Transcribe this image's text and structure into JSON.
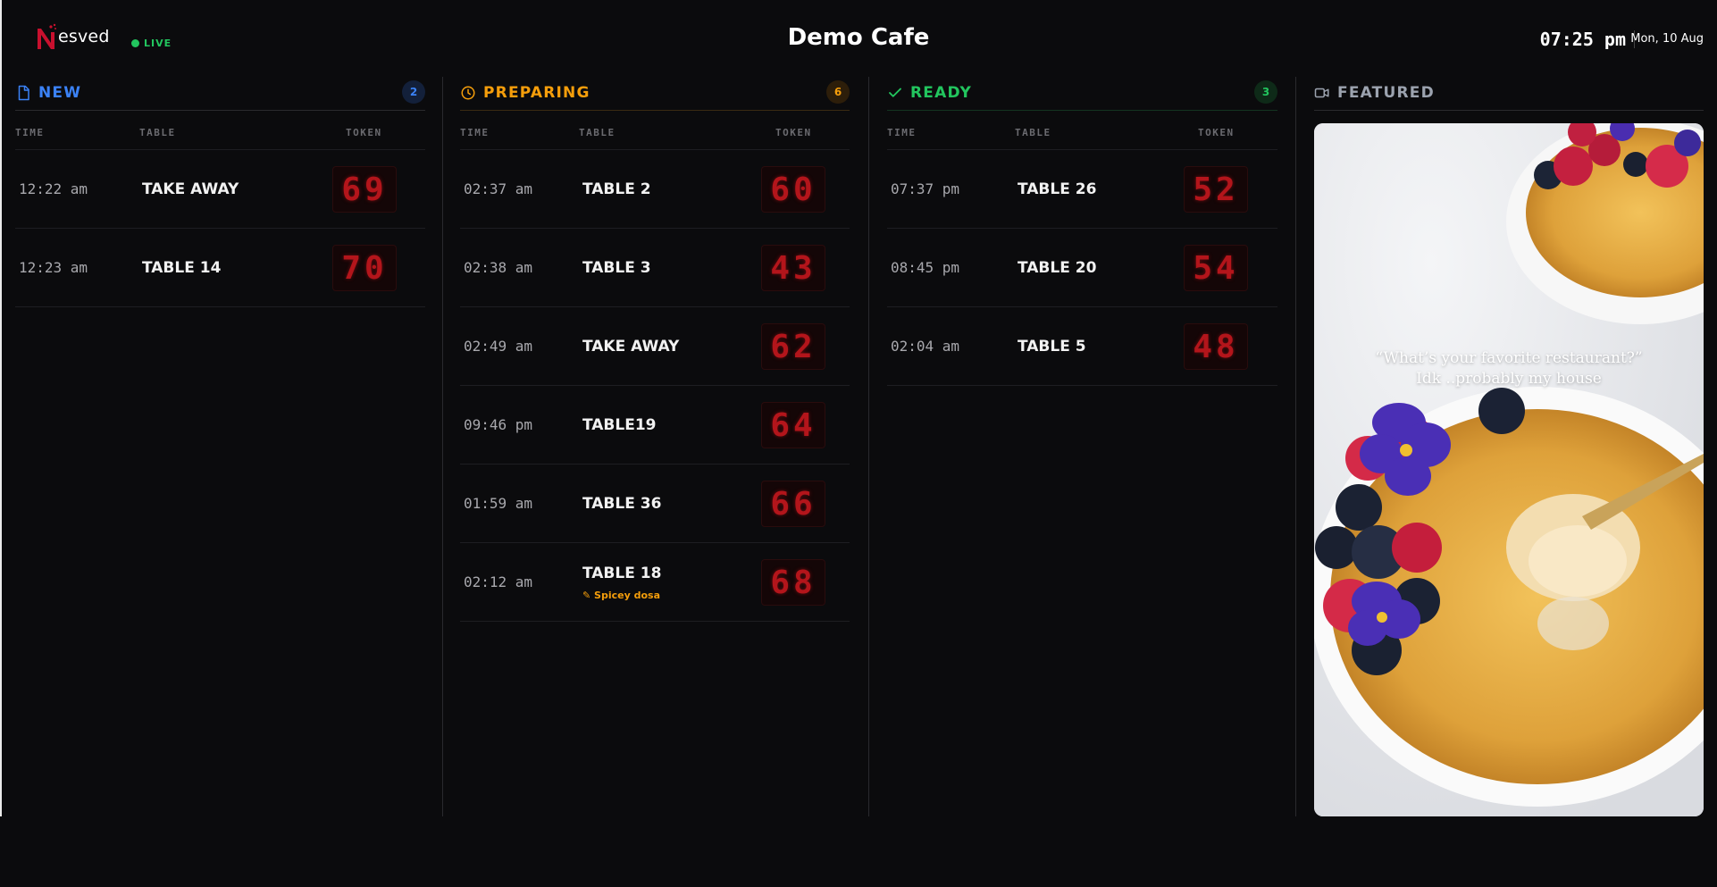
{
  "brand": {
    "logo_text": "esved",
    "live_label": "LIVE"
  },
  "header": {
    "title": "Demo Cafe",
    "time": "07:25 pm",
    "date": "Mon, 10 Aug"
  },
  "colors": {
    "new": "#3b82f6",
    "preparing": "#f59e0b",
    "ready": "#22c55e",
    "featured": "#9ca3af",
    "token": "#b3151b"
  },
  "table_headers": {
    "time": "TIME",
    "table": "TABLE",
    "token": "TOKEN"
  },
  "columns": {
    "new": {
      "title": "NEW",
      "icon": "document-icon",
      "count": "2",
      "rows": [
        {
          "time": "12:22 am",
          "table": "TAKE AWAY",
          "token": "69"
        },
        {
          "time": "12:23 am",
          "table": "TABLE 14",
          "token": "70"
        }
      ]
    },
    "preparing": {
      "title": "PREPARING",
      "icon": "clock-icon",
      "count": "6",
      "rows": [
        {
          "time": "02:37 am",
          "table": "TABLE 2",
          "token": "60"
        },
        {
          "time": "02:38 am",
          "table": "TABLE 3",
          "token": "43"
        },
        {
          "time": "02:49 am",
          "table": "TAKE AWAY",
          "token": "62"
        },
        {
          "time": "09:46 pm",
          "table": "TABLE19",
          "token": "64"
        },
        {
          "time": "01:59 am",
          "table": "TABLE 36",
          "token": "66"
        },
        {
          "time": "02:12 am",
          "table": "TABLE 18",
          "token": "68",
          "note": "✎ Spicey dosa"
        }
      ]
    },
    "ready": {
      "title": "READY",
      "icon": "check-icon",
      "count": "3",
      "rows": [
        {
          "time": "07:37 pm",
          "table": "TABLE 26",
          "token": "52"
        },
        {
          "time": "08:45 pm",
          "table": "TABLE 20",
          "token": "54"
        },
        {
          "time": "02:04 am",
          "table": "TABLE 5",
          "token": "48"
        }
      ]
    },
    "featured": {
      "title": "FEATURED",
      "icon": "video-camera-icon",
      "caption_line1": "“What’s your favorite restaurant?”",
      "caption_line2": "Idk ..probably my house"
    }
  }
}
